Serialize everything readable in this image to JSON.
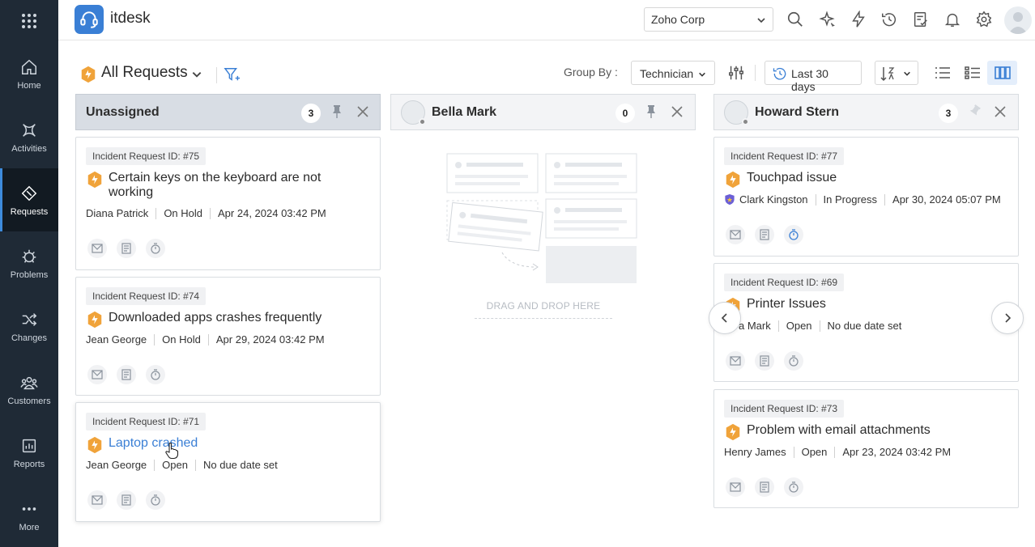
{
  "app": {
    "title": "itdesk"
  },
  "nav": {
    "items": [
      {
        "label": "Home",
        "icon": "home-icon"
      },
      {
        "label": "Activities",
        "icon": "activities-icon"
      },
      {
        "label": "Requests",
        "icon": "requests-icon",
        "active": true
      },
      {
        "label": "Problems",
        "icon": "problems-icon"
      },
      {
        "label": "Changes",
        "icon": "changes-icon"
      },
      {
        "label": "Customers",
        "icon": "customers-icon"
      },
      {
        "label": "Reports",
        "icon": "reports-icon"
      },
      {
        "label": "More",
        "icon": "more-icon"
      }
    ]
  },
  "header": {
    "org_selected": "Zoho Corp",
    "icons": [
      "search-icon",
      "ai-sparkle-icon",
      "lightning-icon",
      "history-icon",
      "tasks-icon",
      "bell-icon",
      "gear-icon",
      "avatar"
    ]
  },
  "toolbar": {
    "view_title": "All Requests",
    "group_by_label": "Group By :",
    "group_by_value": "Technician",
    "date_range": "Last 30 days"
  },
  "columns": [
    {
      "name": "Unassigned",
      "count": "3",
      "cards": [
        {
          "id_label": "Incident Request ID: #75",
          "title": "Certain keys on the keyboard are not working",
          "requester": "Diana Patrick",
          "status": "On Hold",
          "due": "Apr 24, 2024 03:42 PM"
        },
        {
          "id_label": "Incident Request ID: #74",
          "title": "Downloaded apps crashes frequently",
          "requester": "Jean George",
          "status": "On Hold",
          "due": "Apr 29, 2024 03:42 PM"
        },
        {
          "id_label": "Incident Request ID: #71",
          "title": "Laptop crashed",
          "requester": "Jean George",
          "status": "Open",
          "due": "No due date set"
        }
      ]
    },
    {
      "name": "Bella Mark",
      "count": "0",
      "drop_text": "DRAG AND DROP HERE"
    },
    {
      "name": "Howard Stern",
      "count": "3",
      "cards": [
        {
          "id_label": "Incident Request ID: #77",
          "title": "Touchpad issue",
          "requester": "Clark Kingston",
          "status": "In Progress",
          "due": "Apr 30, 2024 05:07 PM"
        },
        {
          "id_label": "Incident Request ID: #69",
          "title": "Printer Issues",
          "requester": "a Mark",
          "status": "Open",
          "due": "No due date set"
        },
        {
          "id_label": "Incident Request ID: #73",
          "title": "Problem with email attachments",
          "requester": "Henry James",
          "status": "Open",
          "due": "Apr 23, 2024 03:42 PM"
        }
      ]
    }
  ],
  "colors": {
    "nav_bg": "#1f2a36",
    "accent": "#3a7fd5",
    "incident_orange": "#f0a33a"
  }
}
